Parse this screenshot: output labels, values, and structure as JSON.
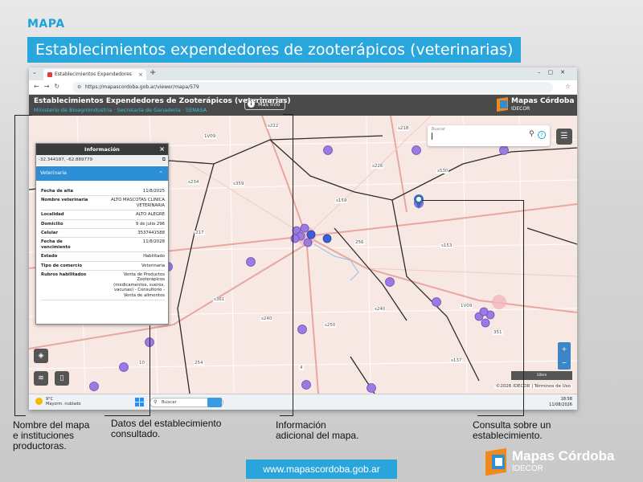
{
  "slide": {
    "section": "MAPA",
    "title": "Establecimientos expendedores de zooterápicos (veterinarias)",
    "footer_url": "www.mapascordoba.gob.ar",
    "logo_name": "Mapas Córdoba",
    "logo_sub": "IDECOR"
  },
  "browser": {
    "tab_title": "Establecimientos Expendedores",
    "url": "https://mapascordoba.gob.ar/viewer/mapa/579"
  },
  "app": {
    "title": "Establecimientos Expendedores de Zooterápicos (veterinarias)",
    "subtitle": "Ministerio de Bioagroindustria · Secretaría de Ganadería · SENASA",
    "info_button": "Más Info",
    "logo_name": "Mapas Córdoba",
    "logo_sub": "IDECOR",
    "search_label": "Buscar"
  },
  "panel": {
    "title": "Información",
    "coords": "-32.344187, -62.889779",
    "section": "Veterinaria",
    "rows": [
      {
        "key": "Fecha de alta",
        "value": "11/8/2025"
      },
      {
        "key": "Nombre veterinaria",
        "value": "ALTO MASCOTAS CLINICA VETERINARIA"
      },
      {
        "key": "Localidad",
        "value": "ALTO ALEGRE"
      },
      {
        "key": "Domicilio",
        "value": "9 de julio 296"
      },
      {
        "key": "Celular",
        "value": "3537441588"
      },
      {
        "key": "Fecha de vencimiento",
        "value": "11/8/2028"
      },
      {
        "key": "Estado",
        "value": "Habilitado"
      },
      {
        "key": "Tipo de comercio",
        "value": "Veterinaria"
      },
      {
        "key": "Rubros habilitados",
        "value": "Venta de Productos Zooterápicos (medicamentos, sueros, vacunas) - Consultorio - Venta de alimentos"
      }
    ]
  },
  "map": {
    "road_labels": [
      "s222",
      "s218",
      "s226",
      "s530",
      "s234",
      "s359",
      "s159",
      "217",
      "256",
      "s153",
      "s361",
      "s240",
      "s250",
      "s240",
      "351",
      "s137",
      "254",
      "10",
      "4",
      "1V09",
      "1V09"
    ],
    "scale": "10km",
    "attribution": "©2026 IDECOR | Términos de Uso"
  },
  "taskbar": {
    "temp": "9°C",
    "weather": "Mayorm. nublado",
    "search": "Buscar",
    "time": "18:58",
    "date": "11/08/2026"
  },
  "annotations": {
    "a1": "Nombre del mapa\ne instituciones\nproductoras.",
    "a2": "Datos del establecimiento\nconsultado.",
    "a3": "Información\nadicional del mapa.",
    "a4": "Consulta sobre un\nestablecimiento."
  },
  "colors": {
    "accent": "#29a7dd",
    "point": "#9b7be0",
    "point_selected": "#3b5fd9",
    "header": "#4a4a4a"
  }
}
